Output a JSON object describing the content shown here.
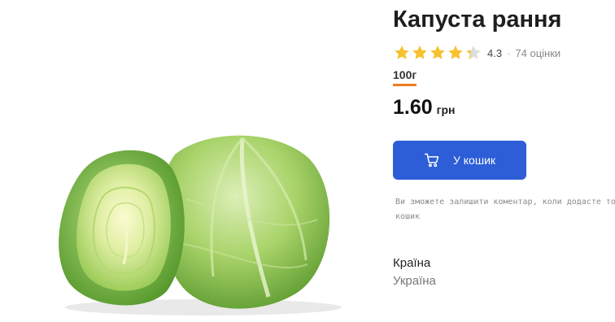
{
  "product": {
    "title": "Капуста рання",
    "rating": {
      "stars_filled": 4.3,
      "stars_total": 5,
      "value": "4.3",
      "separator": "·",
      "count_text": "74 оцінки"
    },
    "weight": "100г",
    "price": {
      "value": "1.60",
      "currency": "грн"
    },
    "cart_button": {
      "label": "У кошик",
      "icon": "shopping-cart-icon"
    },
    "note": "Ви зможете залишити коментар, коли додасте товар у\nкошик",
    "country": {
      "label": "Країна",
      "value": "Україна"
    },
    "image": {
      "subject": "cabbage"
    }
  },
  "colors": {
    "accent": "#2d5dd7",
    "star": "#f7c12f",
    "star_empty": "#dedede",
    "underline": "#f07d1f"
  }
}
